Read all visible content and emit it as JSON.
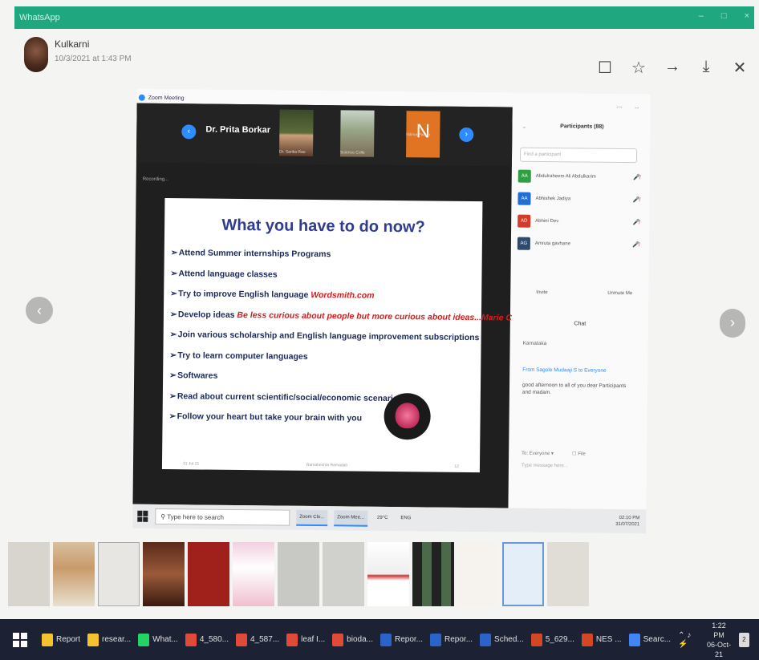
{
  "window": {
    "title": "WhatsApp",
    "controls": [
      "–",
      "□",
      "×"
    ]
  },
  "sender": {
    "name": "Kulkarni",
    "time": "10/3/2021 at 1:43 PM"
  },
  "viewer_actions": {
    "comment": "☐",
    "star": "☆",
    "forward": "→",
    "download": "⤓",
    "close": "✕"
  },
  "nav": {
    "prev": "‹",
    "next": "›"
  },
  "zoom": {
    "title": "Zoom Meeting",
    "speaker": "Dr. Prita Borkar",
    "tiles": [
      {
        "label": "Dr. Sarika Rao"
      },
      {
        "label": "Science Colle"
      },
      {
        "initial": "N",
        "label": "Nilima Pandh"
      }
    ],
    "recording": "Recording...",
    "slide": {
      "title": "What you have to do now?",
      "bullets": [
        {
          "text": "Attend Summer internships Programs",
          "em": ""
        },
        {
          "text": "Attend language classes",
          "em": ""
        },
        {
          "text": "Try to improve English language ",
          "em": "Wordsmith.com"
        },
        {
          "text": "Develop ideas ",
          "em": "Be less curious about people but more curious about ideas...Marie Curie"
        },
        {
          "text": "Join various scholarship and English language improvement subscriptions",
          "em": ""
        },
        {
          "text": "Try to learn computer languages",
          "em": ""
        },
        {
          "text": "Softwares",
          "em": ""
        },
        {
          "text": "Read about current scientific/social/economic scenarios",
          "em": ""
        },
        {
          "text": "Follow your heart but take your brain with you",
          "em": ""
        }
      ],
      "footer_left": "31 Jul 21",
      "footer_mid": "Ramaheshta Ramadati",
      "footer_right": "12"
    },
    "participants": {
      "title": "Participants (88)",
      "find_placeholder": "Find a participant",
      "list": [
        {
          "initials": "AA",
          "name": "Abdulraheem Ali Abdulkarim",
          "color": "#2ea043"
        },
        {
          "initials": "AA",
          "name": "Abhishek Jadiya",
          "color": "#1f6fd6"
        },
        {
          "initials": "AD",
          "name": "Abhini Dev",
          "color": "#d63a2a"
        },
        {
          "initials": "AG",
          "name": "Amruta gavhane",
          "color": "#2f4a6d"
        }
      ],
      "invite": "Invite",
      "unmute": "Unmute Me"
    },
    "chat": {
      "title": "Chat",
      "location": "Karnataka",
      "from": "From Sagole Mudaaji S to Everyone",
      "message": "good afternoon to all of you dear Participants and madam.",
      "to": "To: Everyone ▾",
      "file": "File",
      "placeholder": "Type message here..."
    },
    "taskbar": {
      "search": "Type here to search",
      "items": [
        "Zoom Clo...",
        "Zoom Mee..."
      ],
      "weather": "29°C",
      "lang": "ENG",
      "time": "02:10 PM",
      "date": "31/07/2021"
    }
  },
  "os_taskbar": {
    "items": [
      {
        "label": "Report",
        "color": "#f4c430"
      },
      {
        "label": "resear...",
        "color": "#f4c430"
      },
      {
        "label": "What...",
        "color": "#25d366"
      },
      {
        "label": "4_580...",
        "color": "#e04a3a"
      },
      {
        "label": "4_587...",
        "color": "#e04a3a"
      },
      {
        "label": "leaf I...",
        "color": "#e04a3a"
      },
      {
        "label": "bioda...",
        "color": "#e04a3a"
      },
      {
        "label": "Repor...",
        "color": "#2b63c9"
      },
      {
        "label": "Repor...",
        "color": "#2b63c9"
      },
      {
        "label": "Sched...",
        "color": "#2b63c9"
      },
      {
        "label": "5_629...",
        "color": "#d24726"
      },
      {
        "label": "NES ...",
        "color": "#d24726"
      },
      {
        "label": "Searc...",
        "color": "#4285f4"
      }
    ],
    "time": "1:22 PM",
    "date": "06-Oct-21",
    "notifications": "2"
  }
}
